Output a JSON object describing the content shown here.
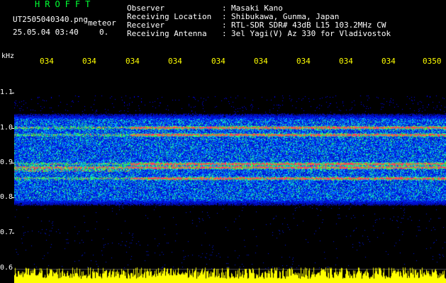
{
  "header": {
    "brand": "HROFFT",
    "filename": "UT2505040340.png",
    "meteor_label": "meteor",
    "datetime": "25.05.04 03:40",
    "count": "0.",
    "fields": [
      {
        "label": "Observer",
        "sep": ":",
        "value": "Masaki Kano"
      },
      {
        "label": "Receiving Location",
        "sep": ":",
        "value": "Shibukawa, Gunma, Japan"
      },
      {
        "label": "Receiver",
        "sep": ":",
        "value": "RTL-SDR SDR# 43dB L15 103.2MHz CW"
      },
      {
        "label": "Receiving Antenna",
        "sep": ":",
        "value": "3el Yagi(V) Az 330 for Vladivostok"
      }
    ]
  },
  "y_axis": {
    "unit": "kHz",
    "ticks": [
      "1.1",
      "1.0",
      "0.9",
      "0.8",
      "0.7",
      "0.6"
    ]
  },
  "x_axis": {
    "ticks": [
      "034",
      "034",
      "034",
      "034",
      "034",
      "034",
      "034",
      "034",
      "034",
      "0350"
    ]
  },
  "colors": {
    "background": "#000000",
    "header_green": "#00ff33",
    "header_text": "#ffffff",
    "time_labels": "#ffff00",
    "noise_bars": "#ffff00"
  },
  "chart_data": {
    "type": "heatmap",
    "y_unit": "kHz",
    "ylim": [
      0.6,
      1.15
    ],
    "signal_band_khz": [
      0.78,
      1.02
    ],
    "bright_lines_khz": [
      0.99,
      0.97,
      0.89,
      0.88,
      0.85
    ],
    "event_start_tick_index": 2
  }
}
